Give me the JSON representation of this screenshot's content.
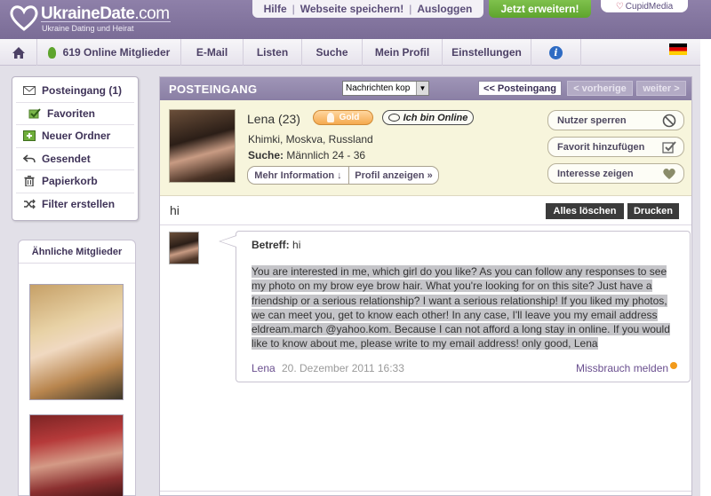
{
  "header": {
    "logo_name": "UkraineDate",
    "logo_suffix": ".com",
    "logo_tagline": "Ukraine Dating und Heirat",
    "top_links": [
      "Hilfe",
      "Webseite speichern!",
      "Ausloggen"
    ],
    "upgrade_label": "Jetzt erweitern!",
    "partner_label": "CupidMedia"
  },
  "nav": {
    "online_label": "619 Online Mitglieder",
    "items": [
      "E-Mail",
      "Listen",
      "Suche",
      "Mein Profil",
      "Einstellungen"
    ],
    "info_label": "i"
  },
  "sidebar": {
    "menu": [
      {
        "label": "Posteingang (1)",
        "icon": "envelope-icon"
      },
      {
        "label": "Favoriten",
        "icon": "checkbox-icon"
      },
      {
        "label": "Neuer Ordner",
        "icon": "new-folder-icon"
      },
      {
        "label": "Gesendet",
        "icon": "reply-arrow-icon"
      },
      {
        "label": "Papierkorb",
        "icon": "trash-icon"
      },
      {
        "label": "Filter erstellen",
        "icon": "shuffle-icon"
      }
    ],
    "similar_title": "Ähnliche Mitglieder"
  },
  "main": {
    "title": "POSTEINGANG",
    "select_value": "Nachrichten kop",
    "back_label": "<< Posteingang",
    "prev_label": "< vorherige",
    "next_label": "weiter >"
  },
  "profile": {
    "name": "Lena (23)",
    "gold_label": "Gold",
    "online_label": "Ich bin Online",
    "location": "Khimki, Moskva, Russland",
    "search_label": "Suche:",
    "search_value": "Männlich 24 - 36",
    "more_info_label": "Mehr Information ↓",
    "view_profile_label": "Profil anzeigen »",
    "actions": [
      {
        "label": "Nutzer sperren",
        "icon": "block-icon"
      },
      {
        "label": "Favorit hinzufügen",
        "icon": "checkbox-icon"
      },
      {
        "label": "Interesse zeigen",
        "icon": "heart-icon"
      }
    ]
  },
  "message": {
    "subject": "hi",
    "delete_all_label": "Alles löschen",
    "print_label": "Drucken",
    "re_label": "Betreff:",
    "re_value": "hi",
    "body": "You are interested in me, which girl do you like? As you can follow any responses to see my photo on my brow eye brow hair. What you're looking for on this site? Just have a friendship or a serious relationship? I want a serious relationship! If you liked my photos, we can meet you, get to know each other! In any case, I'll leave you my email address eldream.march @yahoo.kom. Because I can not afford a long stay in online. If you would like to know about me, please write to my email address! only good, Lena",
    "from": "Lena",
    "date": "20. Dezember 2011 16:33",
    "abuse_label": "Missbrauch melden"
  },
  "colors": {
    "header_purple": "#7a6c96",
    "upgrade_green": "#5ea42d",
    "gold_badge": "#f5a94f",
    "profile_bg": "#f7f5dc",
    "link_purple": "#6a4f8f"
  }
}
